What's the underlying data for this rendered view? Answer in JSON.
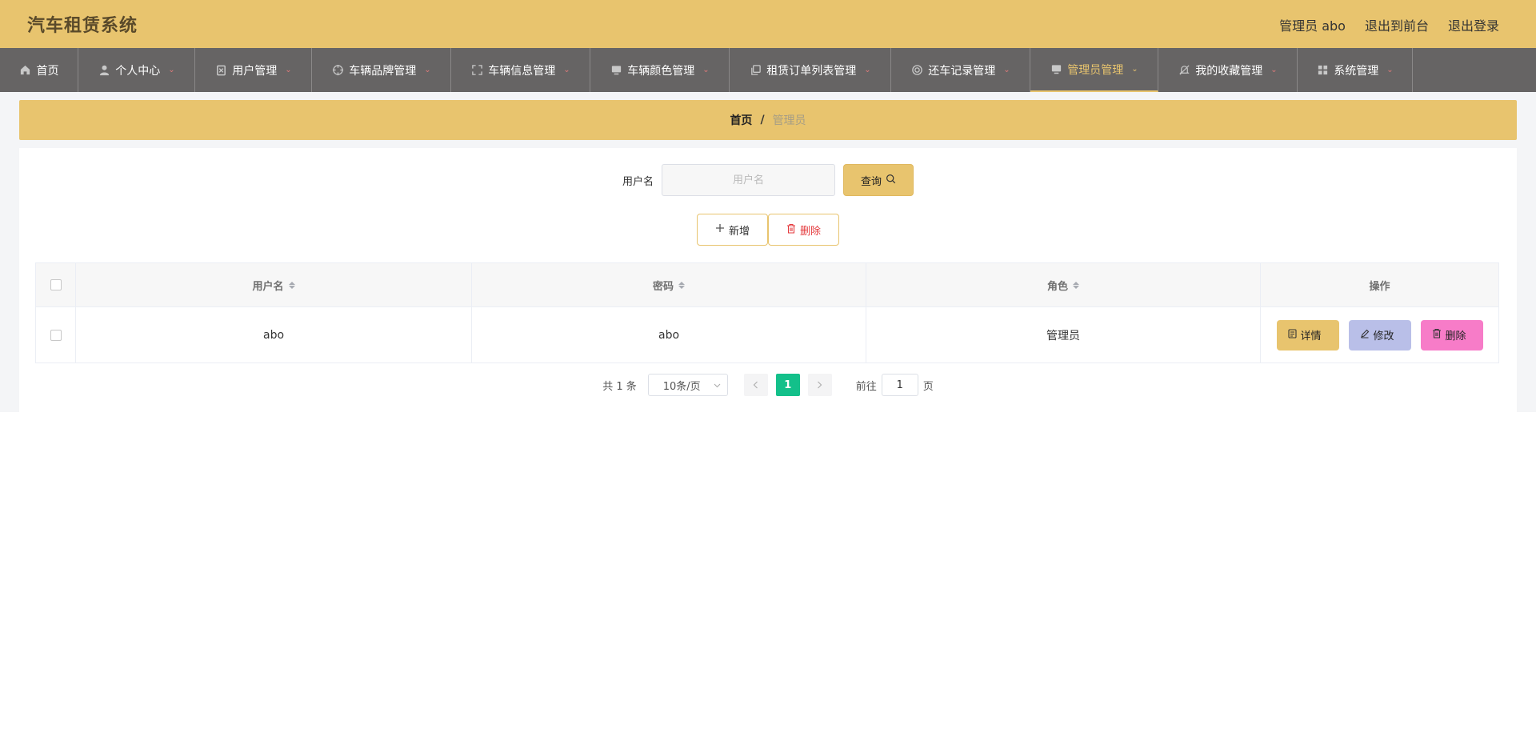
{
  "app": {
    "title": "汽车租赁系统"
  },
  "header_links": {
    "user": "管理员 abo",
    "frontend": "退出到前台",
    "logout": "退出登录"
  },
  "nav": {
    "items": [
      {
        "label": "首页",
        "icon": "home-icon",
        "has_caret": false
      },
      {
        "label": "个人中心",
        "icon": "user-icon",
        "has_caret": true
      },
      {
        "label": "用户管理",
        "icon": "clipboard-icon",
        "has_caret": true
      },
      {
        "label": "车辆品牌管理",
        "icon": "target-icon",
        "has_caret": true
      },
      {
        "label": "车辆信息管理",
        "icon": "fullscreen-icon",
        "has_caret": true
      },
      {
        "label": "车辆颜色管理",
        "icon": "monitor-icon",
        "has_caret": true
      },
      {
        "label": "租赁订单列表管理",
        "icon": "copy-icon",
        "has_caret": true
      },
      {
        "label": "还车记录管理",
        "icon": "lifebuoy-icon",
        "has_caret": true
      },
      {
        "label": "管理员管理",
        "icon": "monitor-icon",
        "has_caret": true,
        "active": true
      },
      {
        "label": "我的收藏管理",
        "icon": "bell-off-icon",
        "has_caret": true
      },
      {
        "label": "系统管理",
        "icon": "grid-icon",
        "has_caret": true
      }
    ]
  },
  "breadcrumb": {
    "home": "首页",
    "separator": "/",
    "current": "管理员"
  },
  "search": {
    "label": "用户名",
    "placeholder": "用户名",
    "value": "",
    "button": "查询"
  },
  "actions": {
    "add": "新增",
    "delete": "删除"
  },
  "table": {
    "headers": {
      "username": "用户名",
      "password": "密码",
      "role": "角色",
      "operation": "操作"
    },
    "rows": [
      {
        "username": "abo",
        "password": "abo",
        "role": "管理员"
      }
    ],
    "row_buttons": {
      "detail": "详情",
      "edit": "修改",
      "delete": "删除"
    }
  },
  "pagination": {
    "total": "共 1 条",
    "page_size": "10条/页",
    "current_page": "1",
    "goto_label": "前往",
    "goto_value": "1",
    "page_suffix": "页"
  },
  "colors": {
    "accent": "#e8c46e",
    "nav_bg": "#666464",
    "active_page": "#13c08a",
    "edit_btn": "#b9bfe8",
    "delete_btn": "#f77cc8",
    "delete_text": "#e4393c"
  }
}
